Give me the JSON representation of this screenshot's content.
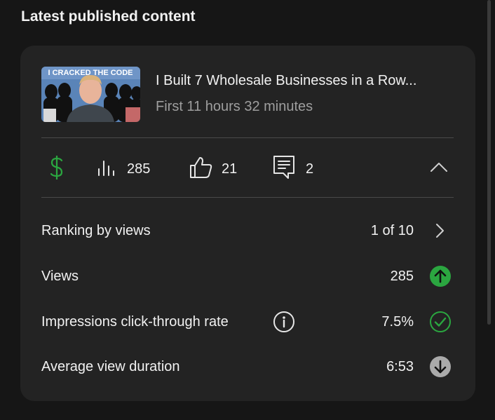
{
  "section": {
    "title": "Latest published content"
  },
  "video": {
    "thumbnail_text": "I CRACKED THE CODE",
    "title": "I Built 7 Wholesale Businesses in a Row...",
    "subtitle": "First 11 hours 32 minutes"
  },
  "metrics": {
    "views_count": "285",
    "likes_count": "21",
    "comments_count": "2"
  },
  "rows": [
    {
      "label": "Ranking by views",
      "value": "1 of 10"
    },
    {
      "label": "Views",
      "value": "285"
    },
    {
      "label": "Impressions click-through rate",
      "value": "7.5%"
    },
    {
      "label": "Average view duration",
      "value": "6:53"
    }
  ],
  "colors": {
    "accent_green": "#2ba640",
    "up_badge": "#2ba640",
    "down_badge": "#aaaaaa"
  },
  "icons": {
    "monetization": "dollar-icon",
    "views": "bar-chart-icon",
    "likes": "thumbs-up-icon",
    "comments": "comment-icon",
    "collapse": "chevron-up-icon"
  }
}
